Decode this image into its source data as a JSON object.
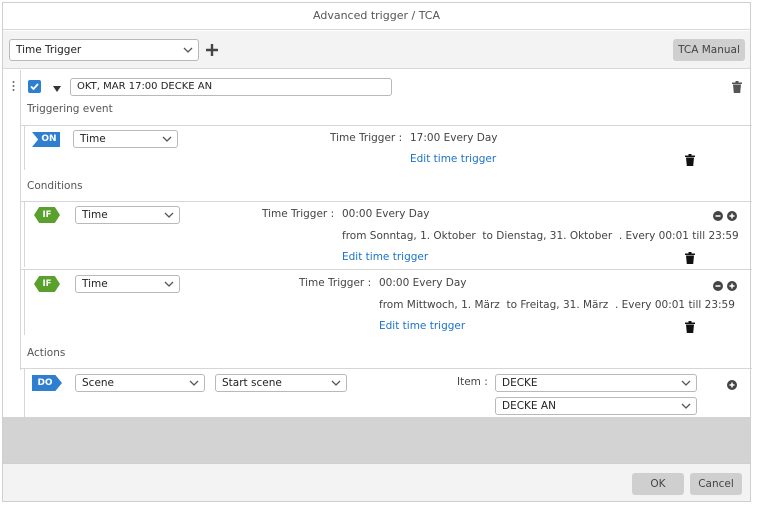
{
  "title": "Advanced trigger / TCA",
  "toolbar": {
    "trigger_type": "Time Trigger",
    "tca_manual": "TCA Manual"
  },
  "rule": {
    "name": "OKT, MAR 17:00 DECKE AN",
    "checked": true
  },
  "triggering": {
    "heading": "Triggering event",
    "badge": "ON",
    "type": "Time",
    "info_label": "Time Trigger :",
    "info_value": "17:00 Every Day",
    "edit_link": "Edit time trigger"
  },
  "conditions": {
    "heading": "Conditions",
    "items": [
      {
        "badge": "IF",
        "type": "Time",
        "info_label": "Time Trigger :",
        "info_value": "00:00 Every Day",
        "range": "from Sonntag, 1. Oktober  to Dienstag, 31. Oktober  . Every 00:01 till 23:59",
        "edit_link": "Edit time trigger"
      },
      {
        "badge": "IF",
        "type": "Time",
        "info_label": "Time Trigger :",
        "info_value": "00:00 Every Day",
        "range": "from Mittwoch, 1. März  to Freitag, 31. März  . Every 00:01 till 23:59",
        "edit_link": "Edit time trigger"
      }
    ]
  },
  "actions": {
    "heading": "Actions",
    "badge": "DO",
    "type": "Scene",
    "command": "Start scene",
    "item_label": "Item :",
    "item_value": "DECKE",
    "scene_value": "DECKE AN"
  },
  "footer": {
    "ok": "OK",
    "cancel": "Cancel"
  },
  "colors": {
    "accent_blue": "#2f7fd1",
    "condition_green": "#5aa02c",
    "link_blue": "#1a73c9"
  }
}
